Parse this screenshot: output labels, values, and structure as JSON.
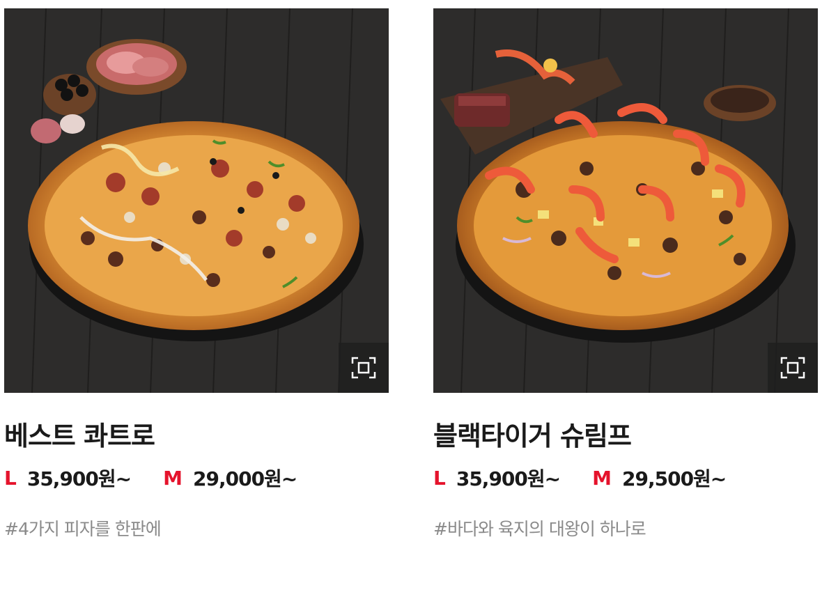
{
  "products": [
    {
      "name": "베스트 콰트로",
      "size_l": "L",
      "price_l": "35,900원~",
      "size_m": "M",
      "price_m": "29,000원~",
      "tag": "#4가지 피자를 한판에",
      "zoom_icon": "expand-icon"
    },
    {
      "name": "블랙타이거 슈림프",
      "size_l": "L",
      "price_l": "35,900원~",
      "size_m": "M",
      "price_m": "29,500원~",
      "tag": "#바다와 육지의 대왕이 하나로",
      "zoom_icon": "expand-icon"
    }
  ],
  "colors": {
    "size_label": "#e5132c",
    "price": "#1a1a1a",
    "tag": "#8a8a8a",
    "photo_background": "#2b2a29"
  }
}
